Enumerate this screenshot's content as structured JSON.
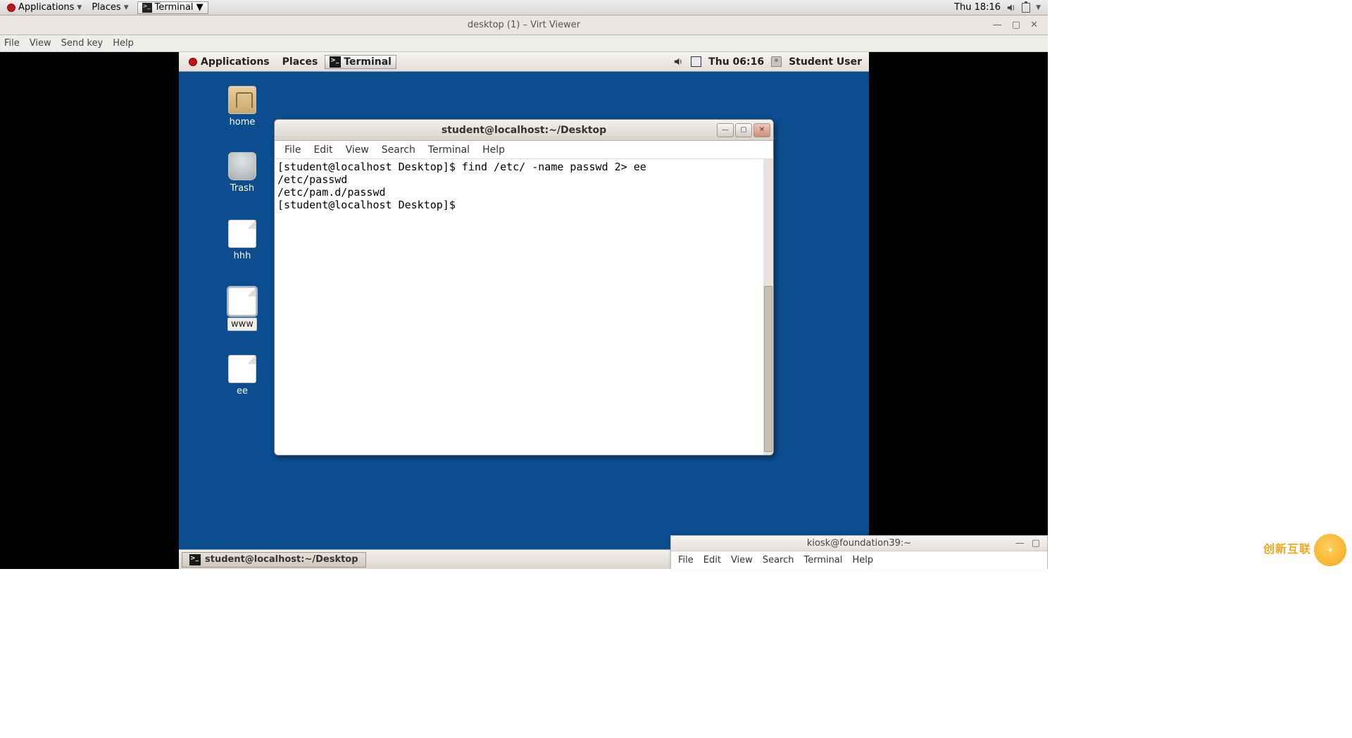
{
  "host_panel": {
    "applications": "Applications",
    "places": "Places",
    "task_terminal": "Terminal",
    "clock": "Thu 18:16"
  },
  "virt_viewer": {
    "title": "desktop (1) – Virt Viewer",
    "menu": {
      "file": "File",
      "view": "View",
      "send_key": "Send key",
      "help": "Help"
    }
  },
  "guest_panel": {
    "applications": "Applications",
    "places": "Places",
    "task_terminal": "Terminal",
    "clock": "Thu 06:16",
    "user": "Student User"
  },
  "desktop_icons": {
    "home": "home",
    "trash": "Trash",
    "hhh": "hhh",
    "www": "www",
    "ee": "ee"
  },
  "terminal": {
    "title": "student@localhost:~/Desktop",
    "menu": {
      "file": "File",
      "edit": "Edit",
      "view": "View",
      "search": "Search",
      "terminal": "Terminal",
      "help": "Help"
    },
    "line1": "[student@localhost Desktop]$ find /etc/ -name passwd 2> ee",
    "line2": "/etc/passwd",
    "line3": "/etc/pam.d/passwd",
    "line4": "[student@localhost Desktop]$ "
  },
  "guest_taskbar": {
    "task": "student@localhost:~/Desktop"
  },
  "host_terminal": {
    "title": "kiosk@foundation39:~",
    "menu": {
      "file": "File",
      "edit": "Edit",
      "view": "View",
      "search": "Search",
      "terminal": "Terminal",
      "help": "Help"
    }
  },
  "watermark": {
    "text": "创新互联"
  }
}
